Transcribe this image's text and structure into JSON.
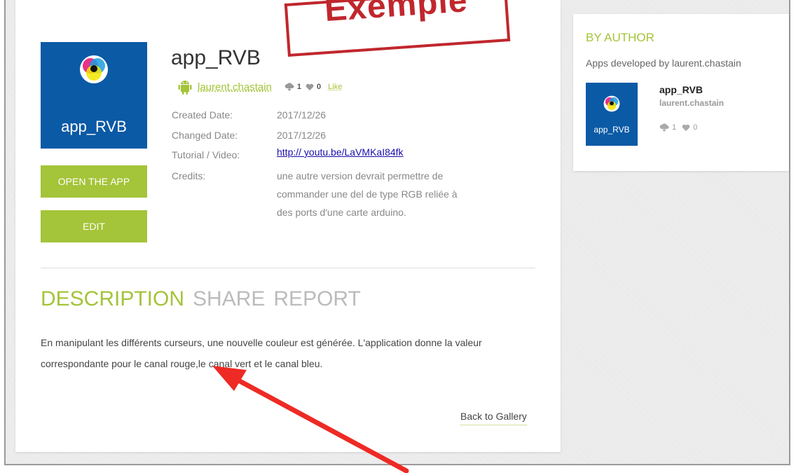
{
  "app": {
    "title": "app_RVB",
    "icon_label": "app_RVB",
    "author": "laurent.chastain",
    "downloads": "1",
    "likes": "0",
    "like_link": "Like"
  },
  "buttons": {
    "open": "OPEN THE APP",
    "edit": "EDIT"
  },
  "meta": {
    "created_label": "Created Date:",
    "created_value": "2017/12/26",
    "changed_label": "Changed Date:",
    "changed_value": "2017/12/26",
    "tutorial_label": "Tutorial / Video:",
    "tutorial_value": "http:// youtu.be/LaVMKaI84fk",
    "credits_label": "Credits:",
    "credits_value": "une autre version devrait permettre de commander une del de type RGB reliée à des ports d'une carte arduino."
  },
  "tabs": [
    "DESCRIPTION",
    "SHARE",
    "REPORT"
  ],
  "description": "En manipulant les différents curseurs, une nouvelle couleur est générée. L'application donne la valeur correspondante pour le canal rouge,le canal vert et le canal bleu.",
  "back_link": "Back to Gallery",
  "sidebar": {
    "heading": "BY AUTHOR",
    "subheading": "Apps developed by laurent.chastain",
    "item": {
      "title": "app_RVB",
      "author": "laurent.chastain",
      "icon_label": "app_RVB",
      "downloads": "1",
      "likes": "0"
    }
  },
  "stamp": "Exemple",
  "colors": {
    "accent": "#a4c439",
    "icon_bg": "#0b5aa6",
    "stamp": "#c0272d",
    "arrow": "#ee2a24"
  },
  "icons": [
    "android-icon",
    "download-cloud-icon",
    "heart-icon",
    "rgb-circles-icon"
  ]
}
